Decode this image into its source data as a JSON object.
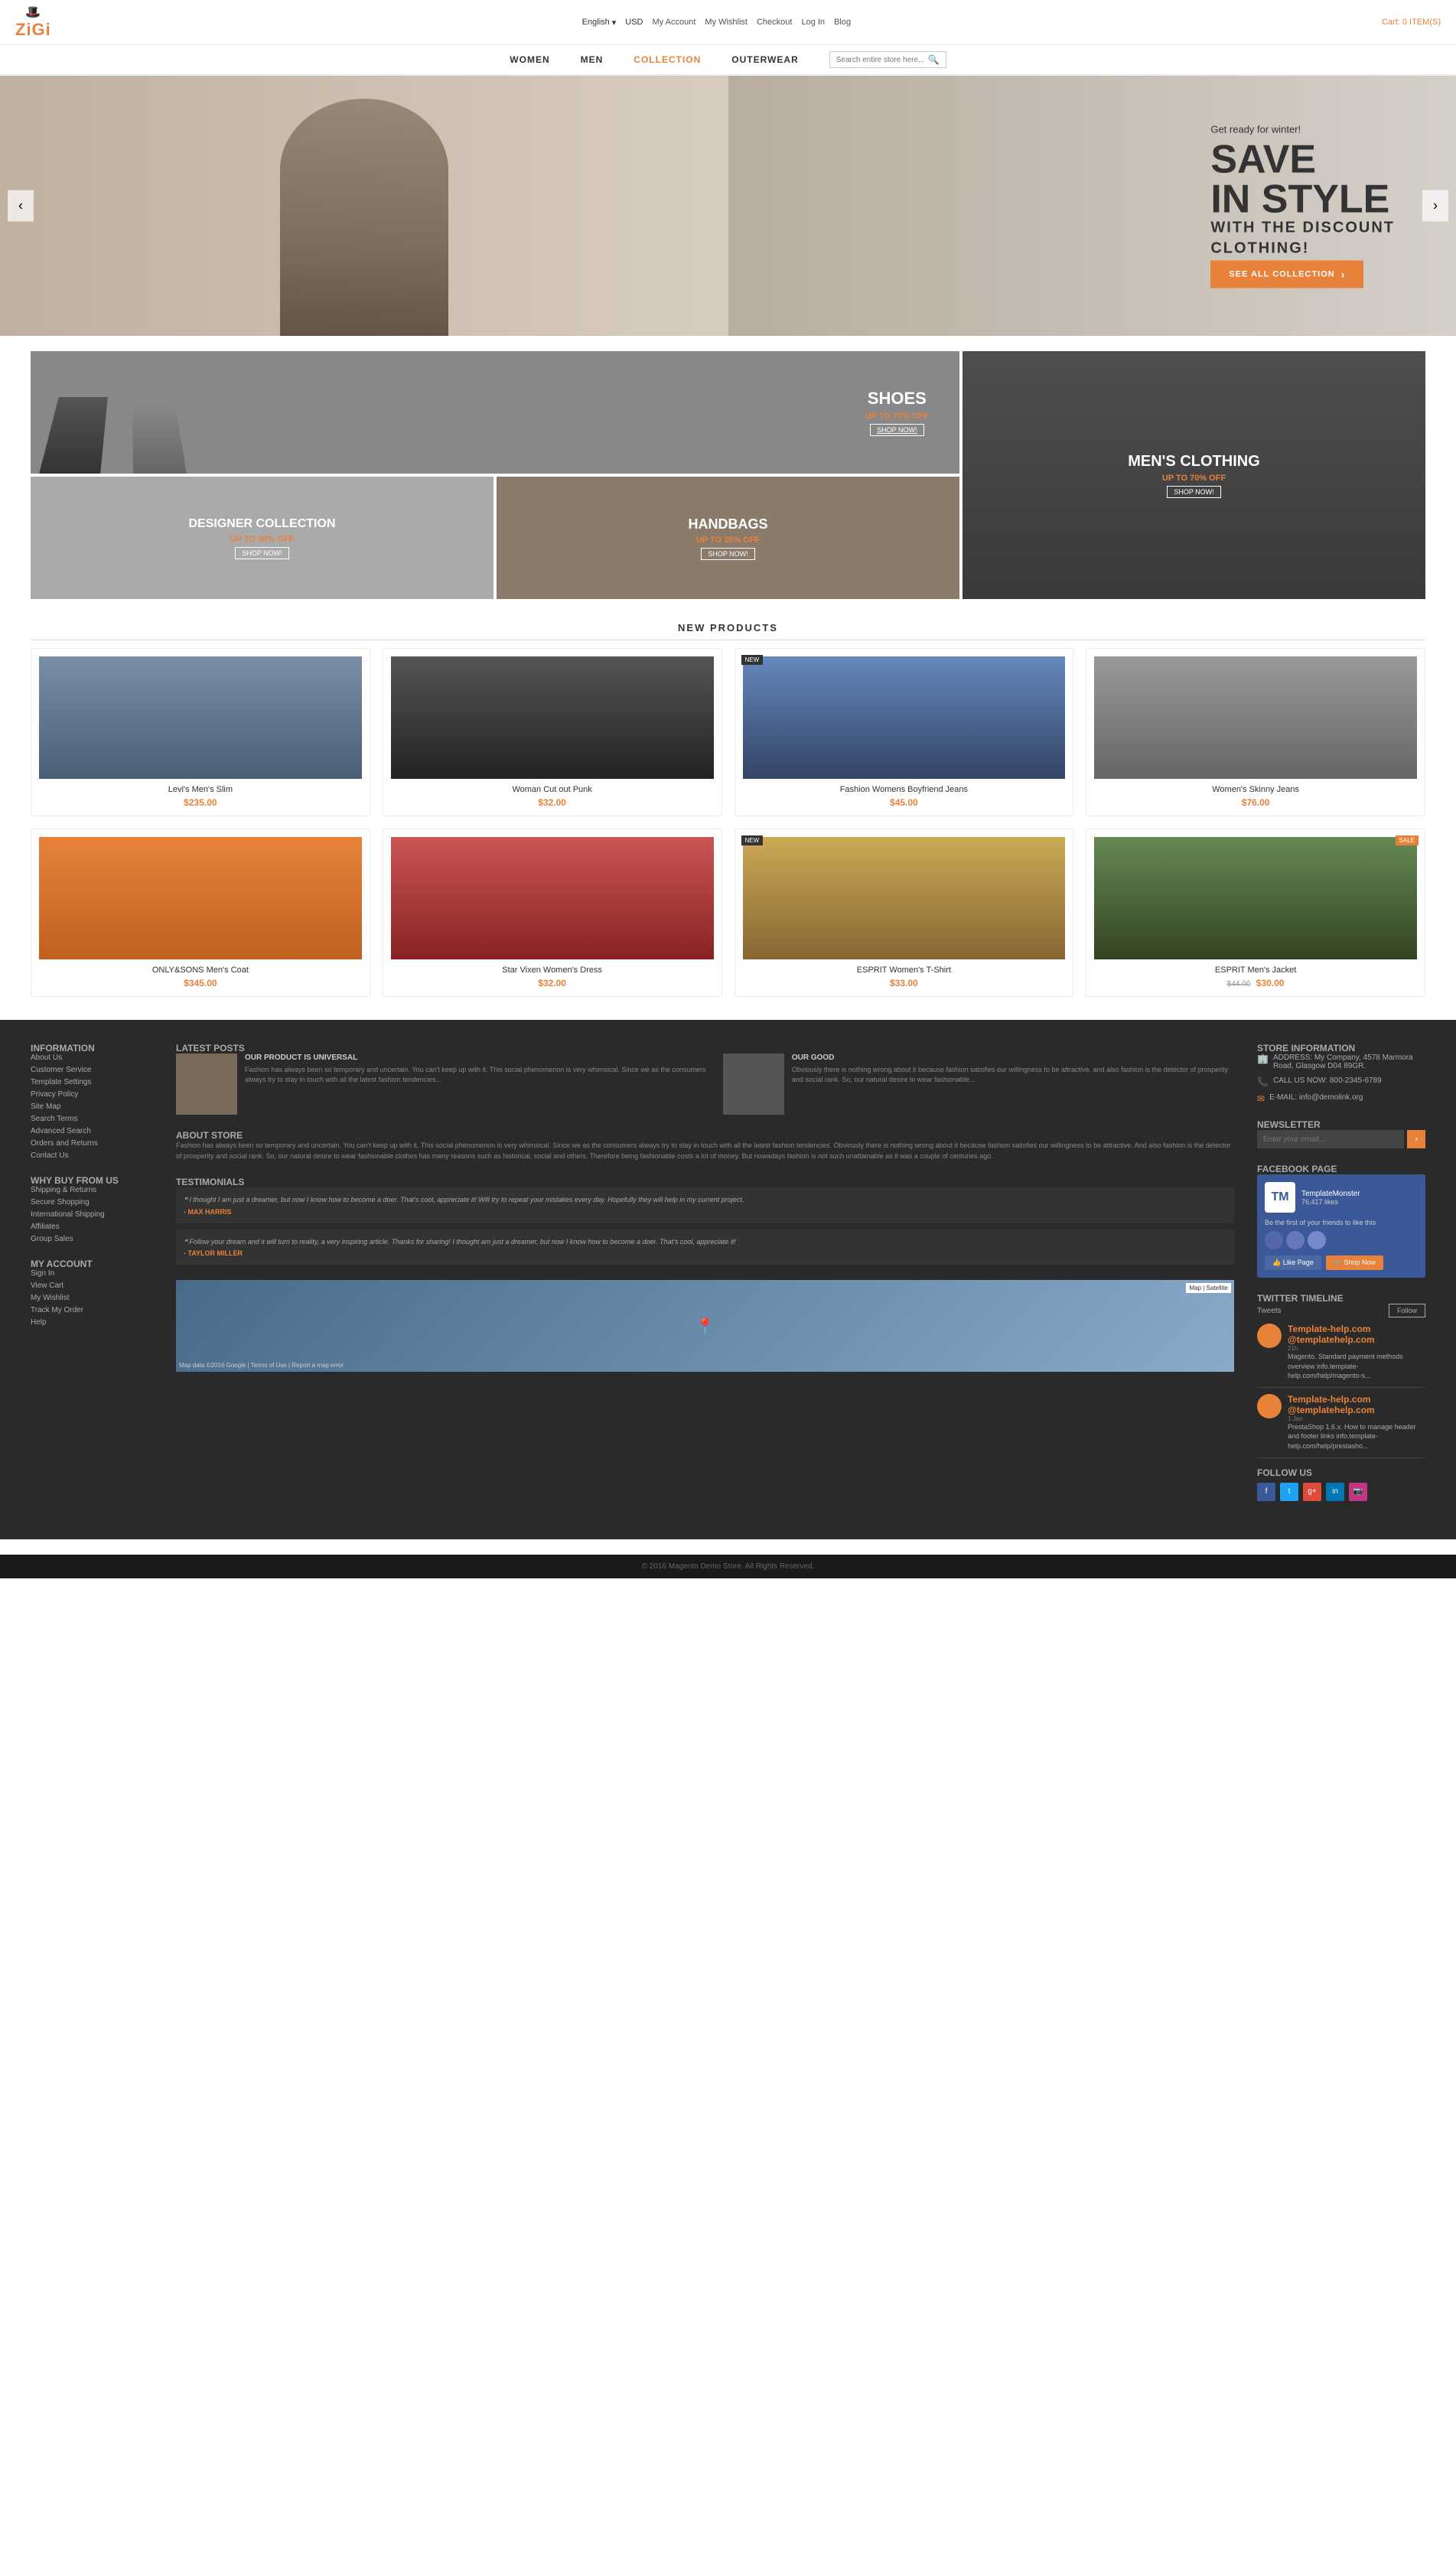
{
  "brand": {
    "name": "ZiGi",
    "icon": "🎩"
  },
  "topbar": {
    "language": "English",
    "currency": "USD",
    "links": [
      "My Account",
      "My Wishlist",
      "Checkout",
      "Log In",
      "Blog"
    ],
    "cart": "Cart: 0 ITEM(S)"
  },
  "nav": {
    "items": [
      "WOMEN",
      "MEN",
      "COLLECTION",
      "OUTERWEAR"
    ],
    "search_placeholder": "Search entire store here..."
  },
  "hero": {
    "pretitle": "Get ready for winter!",
    "title1": "SAVE",
    "title2": "IN STYLE",
    "subtitle": "WITH THE DISCOUNT",
    "desc": "CLOTHING!",
    "cta": "SEE ALL COLLECTION"
  },
  "promo": {
    "shoes": {
      "title": "SHOES",
      "discount": "UP TO 70% OFF",
      "link": "SHOP NOW!"
    },
    "designer": {
      "title": "DESIGNER COLLECTION",
      "discount": "UP TO 30% OFF",
      "link": "SHOP NOW!"
    },
    "handbags": {
      "title": "HANDBAGS",
      "discount": "UP TO 30% OFF",
      "link": "SHOP NOW!"
    },
    "mens": {
      "title": "MEN'S CLOTHING",
      "discount": "UP TO 70% OFF",
      "link": "SHOP NOW!"
    }
  },
  "new_products": {
    "section_title": "NEW PRODUCTS",
    "items": [
      {
        "name": "Levi's Men's Slim",
        "price": "$235.00",
        "color": "prod-blue",
        "badge": ""
      },
      {
        "name": "Woman Cut out Punk",
        "price": "$32.00",
        "color": "prod-black",
        "badge": ""
      },
      {
        "name": "Fashion Womens Boyfriend Jeans",
        "price": "$45.00",
        "color": "prod-denim",
        "badge": "New"
      },
      {
        "name": "Women's Skinny Jeans",
        "price": "$76.00",
        "color": "prod-gray",
        "badge": ""
      },
      {
        "name": "ONLY&SONS Men's Coat",
        "price": "$345.00",
        "color": "prod-orange",
        "badge": ""
      },
      {
        "name": "Star Vixen Women's Dress",
        "price": "$32.00",
        "color": "prod-red",
        "badge": ""
      },
      {
        "name": "ESPRIT Women's T-Shirt",
        "price": "$33.00",
        "color": "prod-yellow",
        "badge": "New"
      },
      {
        "name": "ESPRIT Men's Jacket",
        "price_old": "$44.00",
        "price": "$30.00",
        "color": "prod-green",
        "badge": "Sale"
      }
    ]
  },
  "footer": {
    "information": {
      "title": "INFORMATION",
      "links": [
        "About Us",
        "Customer Service",
        "Template Settings",
        "Privacy Policy",
        "Site Map",
        "Search Terms",
        "Advanced Search",
        "Orders and Returns",
        "Contact Us"
      ]
    },
    "why_buy": {
      "title": "WHY BUY FROM US",
      "links": [
        "Shipping & Returns",
        "Secure Shopping",
        "International Shipping",
        "Affiliates",
        "Group Sales"
      ]
    },
    "my_account": {
      "title": "MY ACCOUNT",
      "links": [
        "Sign In",
        "View Cart",
        "My Wishlist",
        "Track My Order",
        "Help"
      ]
    },
    "latest_posts": {
      "title": "LATEST POSTS",
      "post1": {
        "heading": "OUR PRODUCT IS UNIVERSAL",
        "text": "Fashion has always been so temporary and uncertain. You can't keep up with it. This social phenomenon is very whimsical. Since we as the consumers always try to stay in touch with all the latest fashion tendencies..."
      },
      "post2": {
        "heading": "OUR GOOD",
        "text": "Obviously there is nothing wrong about it because fashion satisfies our willingness to be attractive, and also fashion is the detector of prosperity and social rank. So, our natural desire to wear fashionable..."
      }
    },
    "about_store": {
      "title": "ABOUT STORE",
      "text": "Fashion has always been so temporary and uncertain. You can't keep up with it. This social phenomenon is very whimsical. Since we as the consumers always try to stay in touch with all the latest fashion tendencies. Obviously there is nothing wrong about it because fashion satisfies our willingness to be attractive. And also fashion is the detector of prosperity and social rank. So, our natural desire to wear fashionable clothes has many reasons such as historical, social and others. Therefore being fashionable costs a lot of money. But nowadays fashion is not such unattainable as it was a couple of centuries ago."
    },
    "testimonials": {
      "title": "TESTIMONIALS",
      "items": [
        {
          "text": "I thought I am just a dreamer, but now I know how to become a doer. That's cool, appreciate it! Will try to repeat your mistakes every day. Hopefully they will help in my current project.",
          "author": "- MAX HARRIS"
        },
        {
          "text": "Follow your dream and it will turn to reality, a very inspiring article. Thanks for sharing! I thought am just a dreamer, but now I know how to become a doer. That's cool, appreciate it!",
          "author": "- TAYLOR MILLER"
        }
      ]
    },
    "store_info": {
      "title": "STORE INFORMATION",
      "address": "ADDRESS: My Company, 4578 Marmora Road, Glasgow D04 89GR.",
      "phone": "CALL US NOW: 800-2345-6789",
      "email": "E-MAIL: info@demolink.org"
    },
    "newsletter": {
      "title": "NEWSLETTER",
      "placeholder": "Enter your email..."
    },
    "facebook": {
      "title": "FACEBOOK PAGE",
      "page_name": "TemplateMonster",
      "likes": "76,417 likes"
    },
    "twitter": {
      "title": "TWITTER TIMELINE",
      "tweets_label": "Tweets",
      "follow_label": "Follow",
      "tweets": [
        {
          "handle": "Template-help.com @templatehelp.com",
          "time": "21h",
          "text": "Magento. Standard payment methods overview info.template-help.com/help/magento-s..."
        },
        {
          "handle": "Template-help.com @templatehelp.com",
          "time": "1 Jan",
          "text": "PrestaShop 1.6.x. How to manage header and footer links info.template-help.com/help/prestasho..."
        }
      ]
    },
    "follow_us": {
      "title": "FOLLOW US",
      "icons": [
        "f",
        "t",
        "g+",
        "in",
        "📷"
      ]
    },
    "copyright": "© 2016 Magento Demo Store. All Rights Reserved."
  }
}
